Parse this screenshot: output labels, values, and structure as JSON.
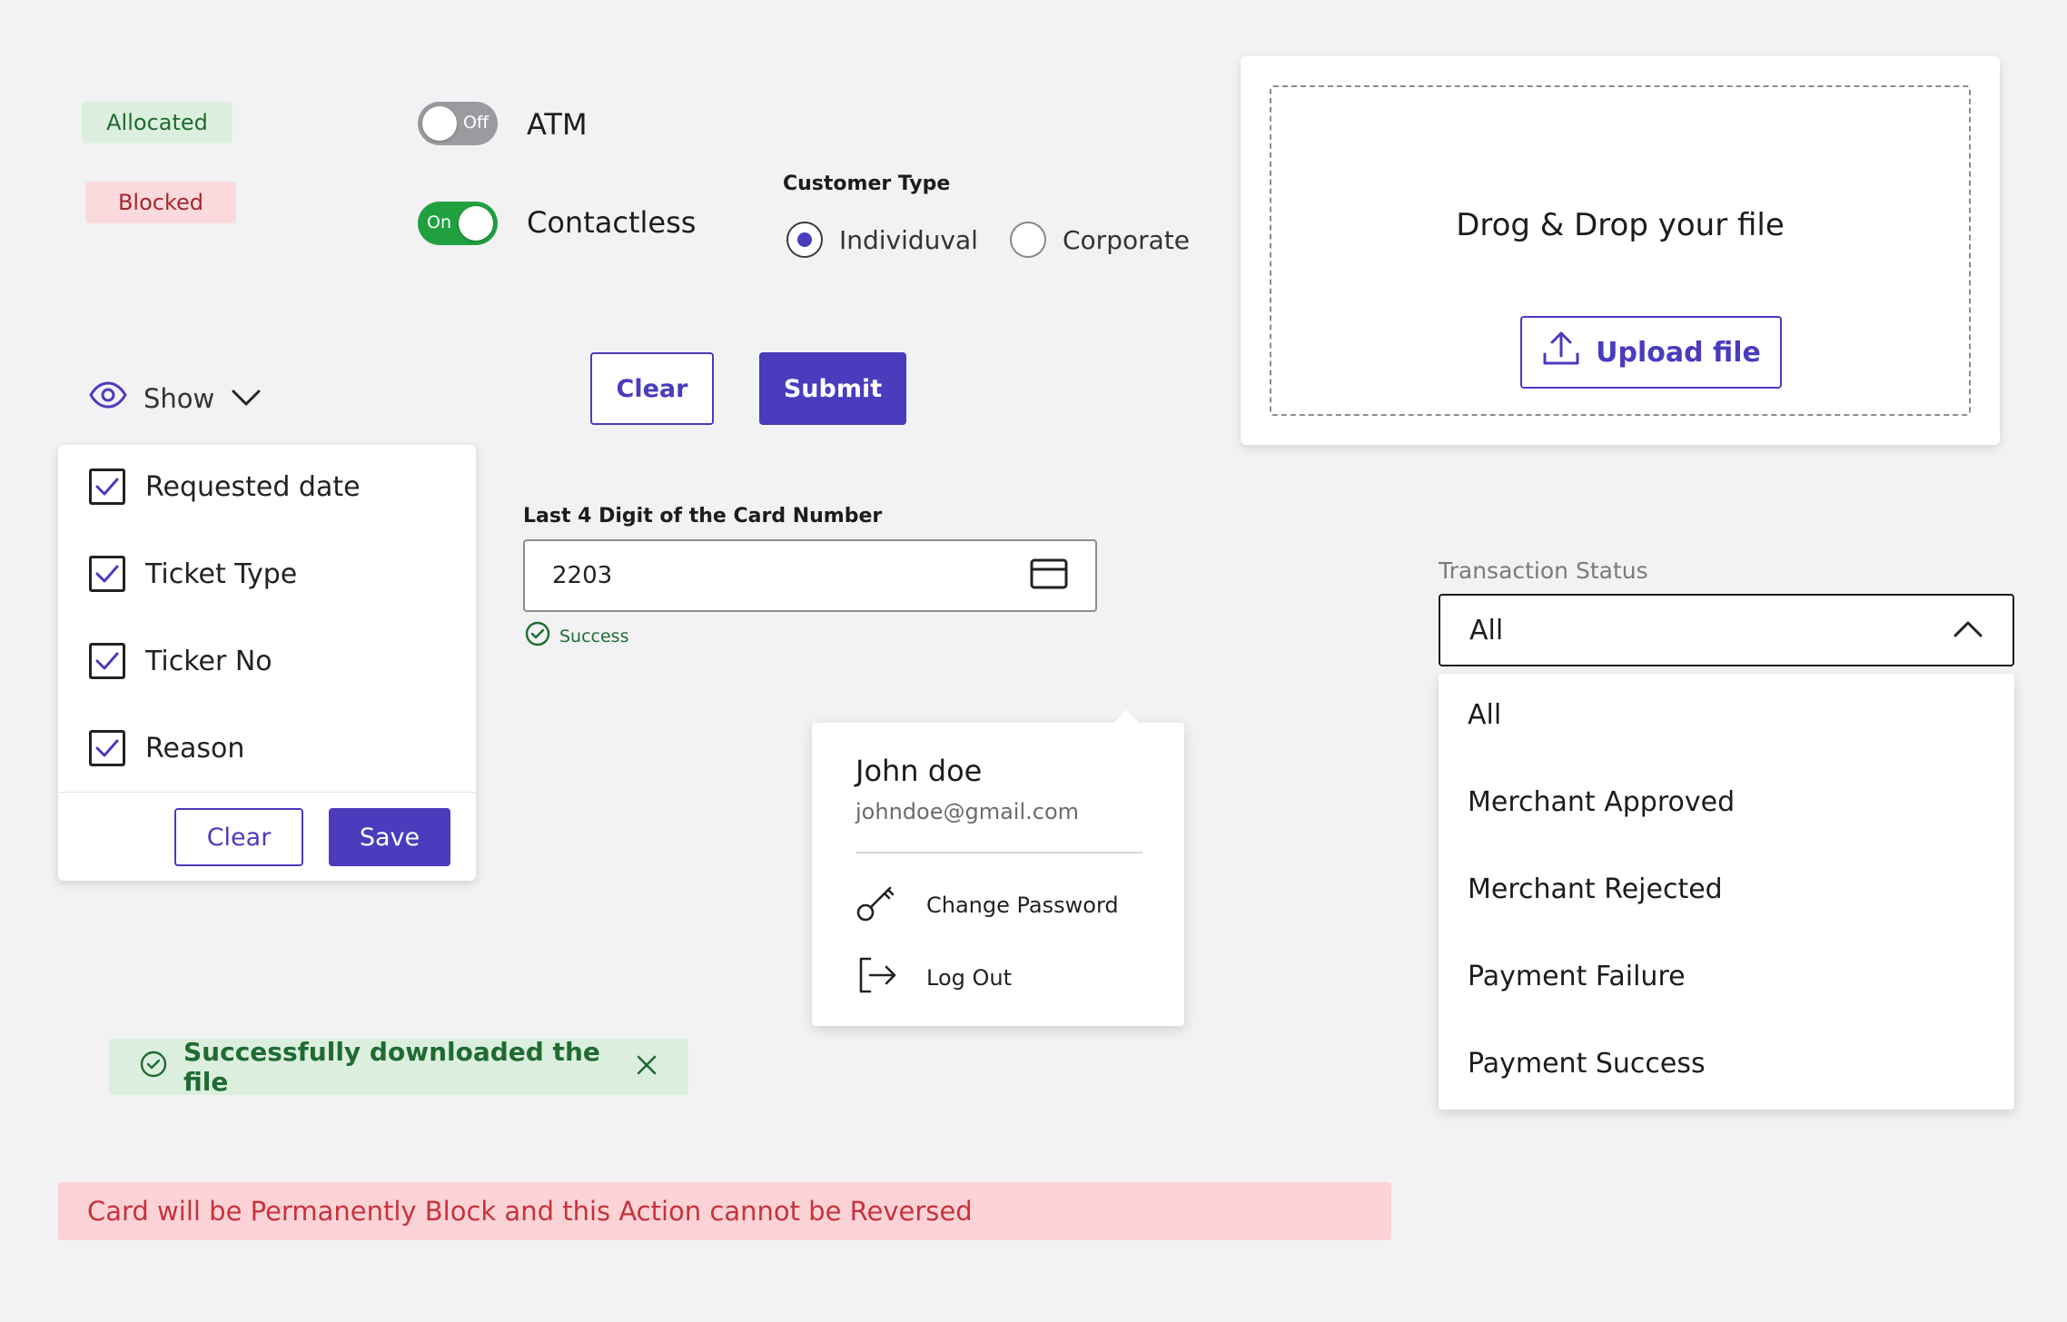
{
  "badges": {
    "allocated": "Allocated",
    "blocked": "Blocked"
  },
  "toggles": [
    {
      "label": "ATM",
      "state_label": "Off",
      "checked": false
    },
    {
      "label": "Contactless",
      "state_label": "On",
      "checked": true
    }
  ],
  "customer_type": {
    "title": "Customer Type",
    "options": [
      "Individuval",
      "Corporate"
    ],
    "selected": "Individuval"
  },
  "form_actions": {
    "clear_label": "Clear",
    "submit_label": "Submit"
  },
  "upload": {
    "title": "Drog & Drop your file",
    "button_label": "Upload file"
  },
  "column_menu": {
    "trigger_label": "Show",
    "items": [
      {
        "label": "Requested date",
        "checked": true
      },
      {
        "label": "Ticket Type",
        "checked": true
      },
      {
        "label": "Ticker No",
        "checked": true
      },
      {
        "label": "Reason",
        "checked": true
      }
    ],
    "clear_label": "Clear",
    "save_label": "Save"
  },
  "card_field": {
    "label": "Last 4 Digit of the Card Number",
    "value": "2203",
    "helper": "Success"
  },
  "profile": {
    "name": "John doe",
    "email": "johndoe@gmail.com",
    "items": [
      "Change Password",
      "Log Out"
    ]
  },
  "transaction_status": {
    "label": "Transaction Status",
    "selected": "All",
    "options": [
      "All",
      "Merchant Approved",
      "Merchant Rejected",
      "Payment Failure",
      "Payment Success"
    ]
  },
  "toast": {
    "message": "Successfully downloaded the file"
  },
  "error_banner": {
    "message": "Card will be Permanently Block and this Action cannot be Reversed"
  },
  "colors": {
    "primary": "#4b3bbd",
    "success": "#1f6b31",
    "success_bg": "#dcefdf",
    "error": "#c8323c",
    "error_bg": "#fbd3d7",
    "toggle_on": "#21a040",
    "toggle_off": "#9a9a9f"
  }
}
